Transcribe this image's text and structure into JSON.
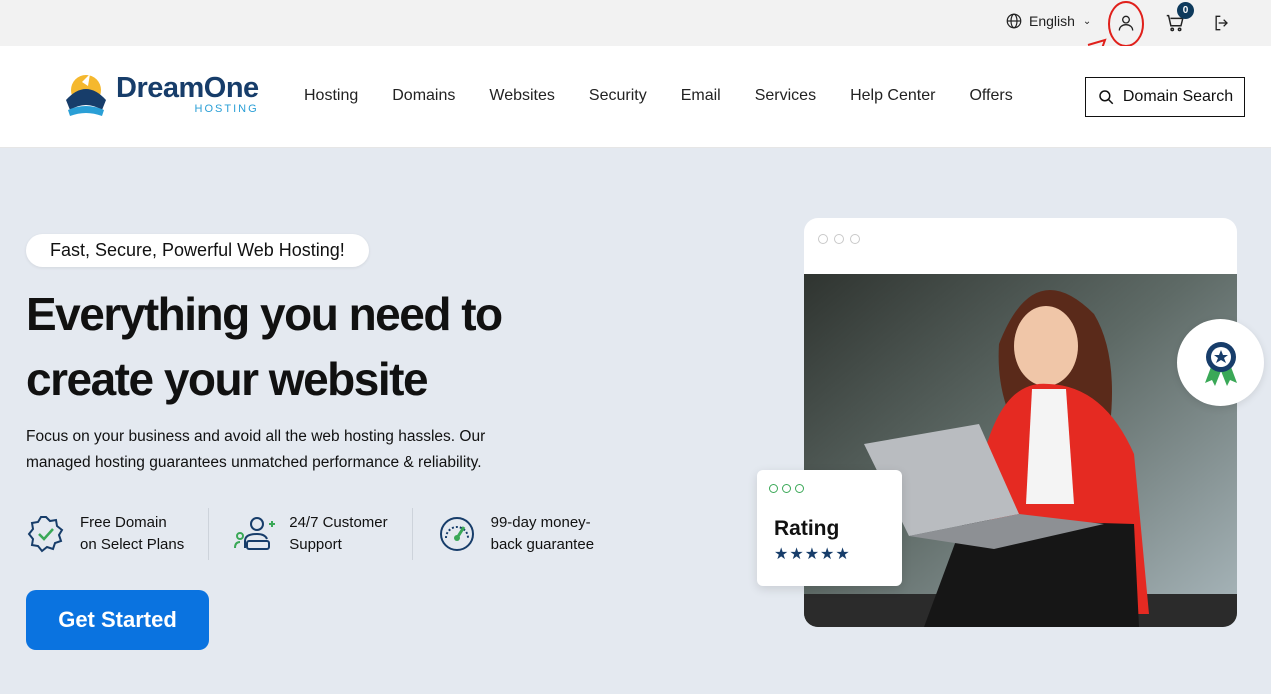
{
  "topbar": {
    "language": "English",
    "cart_count": "0"
  },
  "brand": {
    "name": "DreamOne",
    "sub": "HOSTING"
  },
  "nav": {
    "items": [
      "Hosting",
      "Domains",
      "Websites",
      "Security",
      "Email",
      "Services",
      "Help Center",
      "Offers"
    ],
    "search_label": "Domain Search"
  },
  "hero": {
    "pill": "Fast, Secure, Powerful Web Hosting!",
    "headline_line1": "Everything you need to",
    "headline_line2": "create your website",
    "desc_line1": "Focus on your business and avoid all the web hosting hassles. Our",
    "desc_line2": "managed hosting guarantees unmatched performance & reliability.",
    "features": [
      {
        "line1": "Free Domain",
        "line2": "on Select Plans",
        "icon": "verified-badge-icon"
      },
      {
        "line1": "24/7 Customer",
        "line2": "Support",
        "icon": "support-users-icon"
      },
      {
        "line1": "99-day money-",
        "line2": "back guarantee",
        "icon": "guarantee-gauge-icon"
      }
    ],
    "cta": "Get Started"
  },
  "rating_card": {
    "title": "Rating",
    "stars": "★★★★★"
  },
  "colors": {
    "accent": "#0a73e0",
    "brand_navy": "#173d6a",
    "brand_teal": "#2a9fd6",
    "hero_bg": "#e4e9f0"
  }
}
